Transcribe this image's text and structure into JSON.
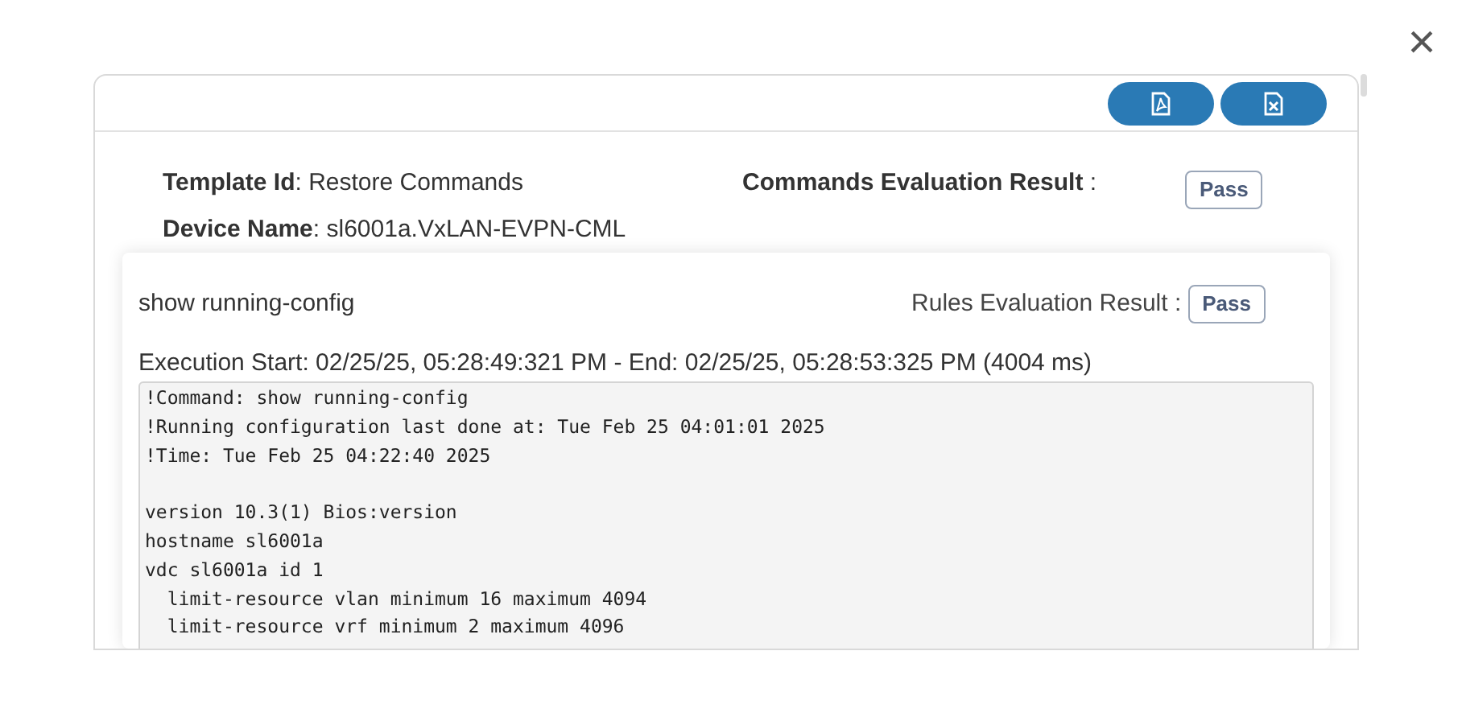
{
  "close_label": "×",
  "export_buttons": [
    {
      "kind": "pdf"
    },
    {
      "kind": "excel"
    }
  ],
  "template": {
    "label": "Template Id",
    "separator": ":",
    "value": "Restore Commands"
  },
  "device": {
    "label": "Device Name",
    "separator": ":",
    "value": "sl6001a.VxLAN-EVPN-CML"
  },
  "commands_result": {
    "label": "Commands Evaluation Result",
    "separator": ":",
    "badge": "Pass"
  },
  "command": {
    "name": "show running-config",
    "rules_result_label": "Rules Evaluation Result :",
    "rules_badge": "Pass",
    "execution": "Execution Start: 02/25/25, 05:28:49:321 PM - End: 02/25/25, 05:28:53:325 PM (4004 ms)",
    "output_blocks": [
      [
        "!Command: show running-config",
        "!Running configuration last done at: Tue Feb 25 04:01:01 2025",
        "!Time: Tue Feb 25 04:22:40 2025"
      ],
      [
        "version 10.3(1) Bios:version",
        "hostname sl6001a",
        "vdc sl6001a id 1",
        "  limit-resource vlan minimum 16 maximum 4094",
        "  limit-resource vrf minimum 2 maximum 4096"
      ]
    ]
  }
}
